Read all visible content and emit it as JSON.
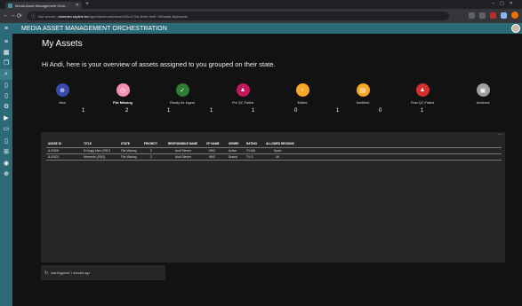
{
  "browser": {
    "tab_title": "Media Asset Management Orch...",
    "url_prefix": "Not secure | ",
    "url_host": "storedev.skyline.be",
    "url_path": "/app/dashboard/asset-ff3c-b74a-4b9b-9e0f-7d0aaad-MyAssets",
    "newtab_glyph": "+",
    "close_glyph": "✕"
  },
  "app": {
    "title": "MEDIA ASSET MANAGEMENT ORCHESTRATION",
    "accent_color": "#2d6a78"
  },
  "page": {
    "title": "My Assets",
    "greeting": "Hi Andi, here is your overview of assets assigned to you grouped on their state."
  },
  "states": [
    {
      "label": "New",
      "icon": "plus-circle-icon",
      "color": "#3949ab",
      "glyph": "⊕"
    },
    {
      "label": "File Missing",
      "icon": "clock-icon",
      "color": "#f48fb1",
      "glyph": "◷"
    },
    {
      "label": "Ready for ingest",
      "icon": "check-icon",
      "color": "#2e7d32",
      "glyph": "✓"
    },
    {
      "label": "Pre QC Failed",
      "icon": "warning-icon",
      "color": "#c2185b",
      "glyph": "▲"
    },
    {
      "label": "Edited",
      "icon": "edit-icon",
      "color": "#f9a825",
      "glyph": "♪"
    },
    {
      "label": "Subtitled",
      "icon": "subtitles-icon",
      "color": "#f9a825",
      "glyph": "▤"
    },
    {
      "label": "Post QC Failed",
      "icon": "warning-icon",
      "color": "#d32f2f",
      "glyph": "▲"
    },
    {
      "label": "Archived",
      "icon": "archive-icon",
      "color": "#9e9e9e",
      "glyph": "▣"
    }
  ],
  "counts": [
    "1",
    "2",
    "1",
    "1",
    "1",
    "0",
    "1",
    "0",
    "1"
  ],
  "table": {
    "headers": [
      "ASSSE ID",
      "TITLE",
      "STATE",
      "PRIORITY",
      "RESPONSIBLE NAME",
      "CP NAME",
      "GENRE",
      "RATING",
      "ALLOWED REGIONS"
    ],
    "rows": [
      [
        "A.00000",
        "El Angry Man (1957)",
        "File Missing",
        "0",
        "Andi Steven",
        "HBO",
        "Action",
        "TV-MA",
        "Spain"
      ],
      [
        "A.00001",
        "Memento (2000)",
        "File Missing",
        "2",
        "Andi Steven",
        "HBO",
        "Drama",
        "TV-G",
        "UK"
      ]
    ]
  },
  "footer": {
    "text": "was triggered 1 minutes ago"
  }
}
